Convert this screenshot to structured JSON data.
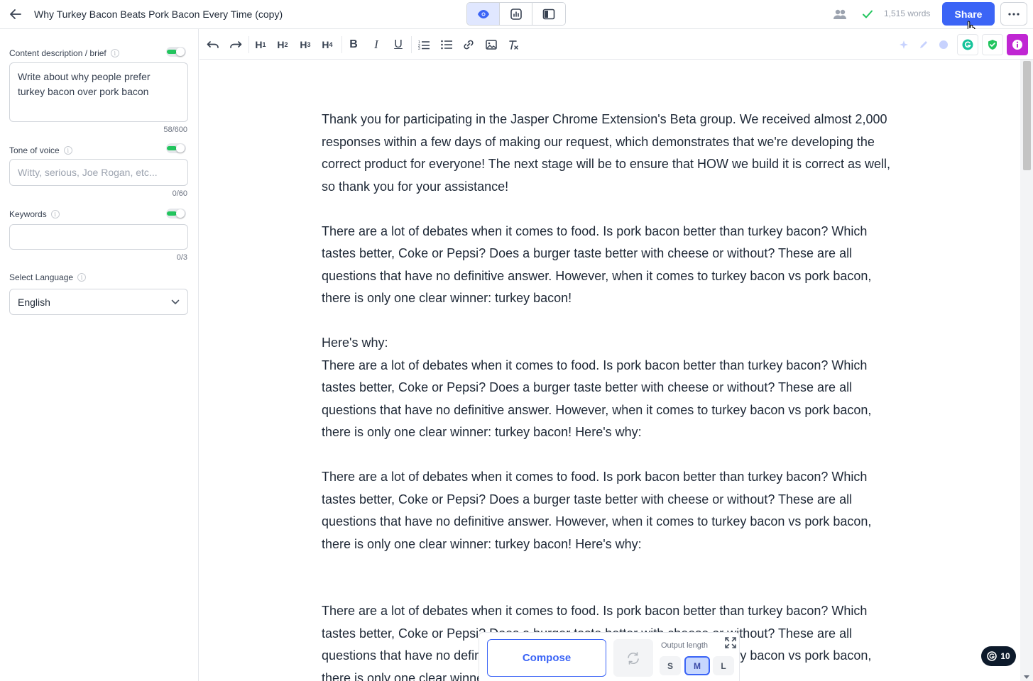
{
  "header": {
    "title": "Why Turkey Bacon Beats Pork Bacon Every Time (copy)",
    "word_count": "1,515 words",
    "share_label": "Share",
    "accent_color": "#3b64f6"
  },
  "sidebar": {
    "brief": {
      "label": "Content description / brief",
      "value": "Write about why people prefer turkey bacon over pork bacon",
      "counter": "58/600"
    },
    "tone": {
      "label": "Tone of voice",
      "placeholder": "Witty, serious, Joe Rogan, etc...",
      "counter": "0/60"
    },
    "keywords": {
      "label": "Keywords",
      "value": "",
      "counter": "0/3"
    },
    "language": {
      "label": "Select Language",
      "value": "English"
    }
  },
  "content": {
    "paragraphs": [
      "Thank you for participating in the Jasper Chrome Extension's Beta group. We received almost 2,000 responses within a few days of making our request, which demonstrates that we're developing the correct product for everyone! The next stage will be to ensure that HOW we build it is correct as well, so thank you for your assistance!",
      "There are a lot of debates when it comes to food. Is pork bacon better than turkey bacon? Which tastes better, Coke or Pepsi? Does a burger taste better with cheese or without? These are all questions that have no definitive answer. However, when it comes to turkey bacon vs pork bacon, there is only one clear winner: turkey bacon!",
      "Here's why:",
      "There are a lot of debates when it comes to food. Is pork bacon better than turkey bacon? Which tastes better, Coke or Pepsi? Does a burger taste better with cheese or without? These are all questions that have no definitive answer. However, when it comes to turkey bacon vs pork bacon, there is only one clear winner: turkey bacon! Here's why:",
      "There are a lot of debates when it comes to food. Is pork bacon better than turkey bacon? Which tastes better, Coke or Pepsi? Does a burger taste better with cheese or without? These are all questions that have no definitive answer. However, when it comes to turkey bacon vs pork bacon, there is only one clear winner: turkey bacon! Here's why:",
      "There are a lot of debates when it comes to food. Is pork bacon better than turkey bacon? Which tastes better, Coke or Pepsi? Does a burger taste better with cheese or without? These are all questions that have no definitive answer. However, when it comes to turkey bacon vs pork bacon, there is only one clear winner: turkey bacon! Here's why:"
    ]
  },
  "compose": {
    "compose_label": "Compose",
    "output_length_label": "Output length",
    "sizes": [
      "S",
      "M",
      "L"
    ],
    "selected_size": "M"
  },
  "grammarly": {
    "count": "10"
  }
}
